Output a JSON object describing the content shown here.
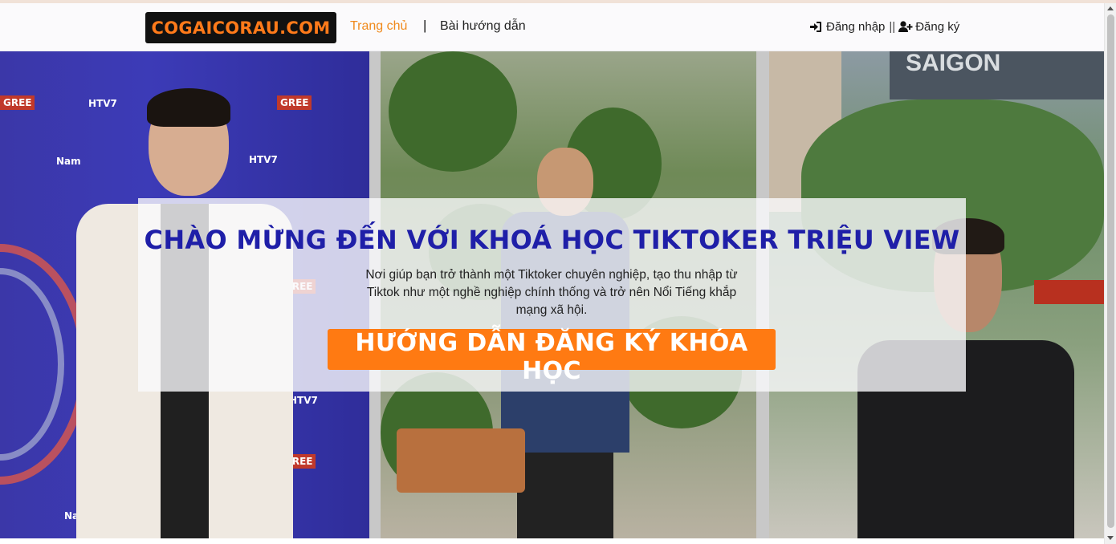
{
  "header": {
    "logo_text": "COGAICORAU.COM",
    "nav": {
      "home": "Trang chủ",
      "separator": "|",
      "guide": "Bài hướng dẫn"
    },
    "auth": {
      "login": "Đăng nhập",
      "divider": "||",
      "register": "Đăng ký",
      "login_icon": "sign-in-icon",
      "register_icon": "user-plus-icon"
    }
  },
  "hero": {
    "title": "CHÀO MỪNG ĐẾN VỚI KHOÁ HỌC TIKTOKER TRIỆU VIEW",
    "subtitle": "Nơi giúp bạn trở thành một Tiktoker chuyên nghiệp, tạo thu nhập từ Tiktok như một nghề nghiệp chính thống và trở nên Nổi Tiếng khắp mạng xã hội.",
    "cta": "HƯỚNG DẪN ĐĂNG KÝ KHÓA HỌC"
  },
  "colors": {
    "accent": "#ff7a12",
    "title_blue": "#1f1fa8",
    "logo_bg": "#111111"
  }
}
